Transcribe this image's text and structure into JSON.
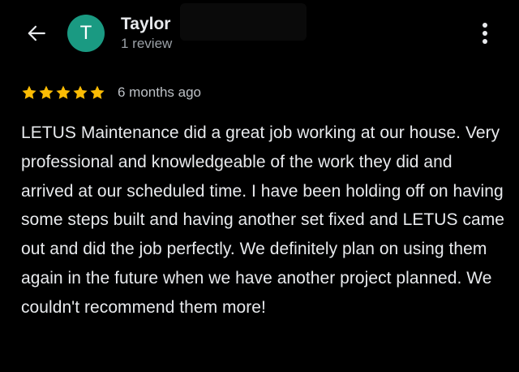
{
  "header": {
    "back_icon": "arrow-left-icon",
    "avatar_letter": "T",
    "avatar_color": "#1a9a82",
    "reviewer_name": "Taylor",
    "review_count": "1 review",
    "menu_icon": "more-vertical-icon"
  },
  "review": {
    "rating": 5,
    "rating_max": 5,
    "star_color": "#fbbc04",
    "time_ago": "6 months ago",
    "text": "LETUS Maintenance did a great job working at our house. Very professional and knowledgeable of the work they did and arrived at our scheduled time. I have been holding off on having some steps built and having another set fixed and LETUS came out and did the job perfectly. We definitely plan on using them again in the future when we have another project planned. We couldn't recommend them more!"
  },
  "theme": {
    "background": "#000000",
    "text_primary": "#e8eaed",
    "text_secondary": "#9aa0a6"
  }
}
